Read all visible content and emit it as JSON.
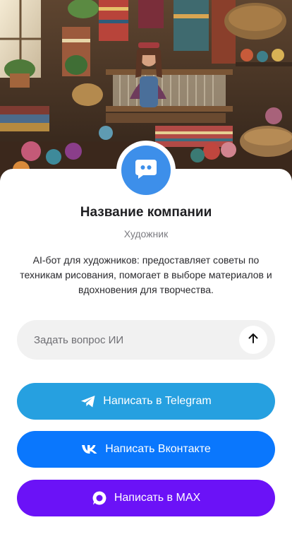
{
  "company": {
    "name": "Название компании",
    "role": "Художник",
    "description": "AI-бот для художников: предоставляет советы по техникам рисования, помогает в выборе материалов и вдохновения для творчества."
  },
  "ask": {
    "placeholder": "Задать вопрос ИИ"
  },
  "buttons": {
    "telegram": "Написать в Telegram",
    "vk": "Написать Вконтакте",
    "max": "Написать в MAX"
  },
  "colors": {
    "avatar": "#3d8fea",
    "telegram": "#26a0e0",
    "vk": "#0a77fd",
    "max": "#6b12f7",
    "ask_bg": "#f1f1f1"
  },
  "icons": {
    "avatar": "chat-bubble-icon",
    "send": "arrow-up-icon",
    "telegram": "telegram-icon",
    "vk": "vk-icon",
    "max": "max-icon"
  }
}
